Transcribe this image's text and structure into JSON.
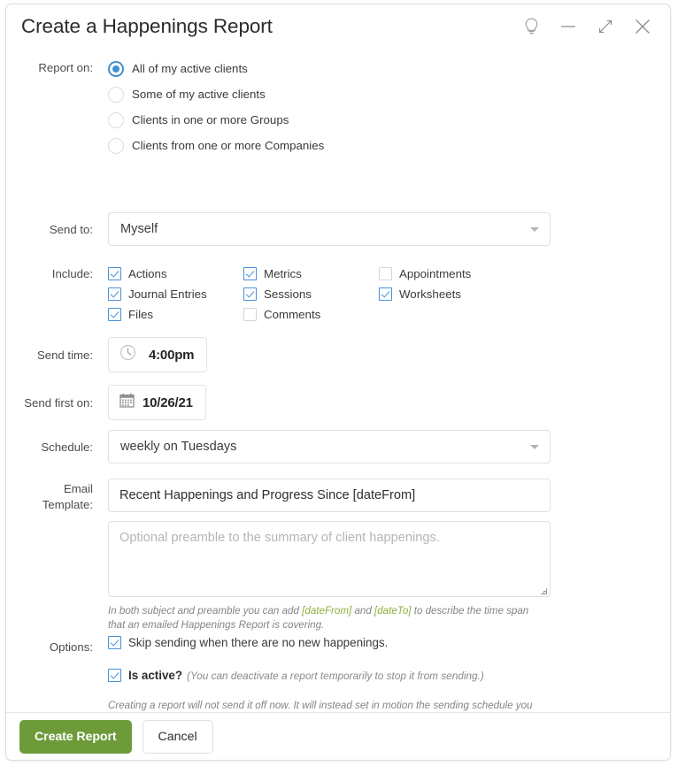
{
  "window": {
    "title": "Create a Happenings Report",
    "controls": [
      {
        "name": "hint-lightbulb-icon",
        "label": "tip"
      },
      {
        "name": "minimize-icon",
        "label": "minimize"
      },
      {
        "name": "collapse-icon",
        "label": "collapse"
      },
      {
        "name": "close-icon",
        "label": "close"
      }
    ]
  },
  "form": {
    "report_on": {
      "label": "Report on:",
      "options": [
        {
          "label": "All of my active clients",
          "selected": true
        },
        {
          "label": "Some of my active clients",
          "selected": false
        },
        {
          "label": "Clients in one or more Groups",
          "selected": false
        },
        {
          "label": "Clients from one or more Companies",
          "selected": false
        }
      ]
    },
    "send_to": {
      "label": "Send to:",
      "value": "Myself"
    },
    "include": {
      "label": "Include:",
      "items": [
        {
          "label": "Actions",
          "checked": true
        },
        {
          "label": "Metrics",
          "checked": true
        },
        {
          "label": "Appointments",
          "checked": false
        },
        {
          "label": "Journal Entries",
          "checked": true
        },
        {
          "label": "Sessions",
          "checked": true
        },
        {
          "label": "Worksheets",
          "checked": true
        },
        {
          "label": "Files",
          "checked": true
        },
        {
          "label": "Comments",
          "checked": false
        }
      ]
    },
    "send_time": {
      "label": "Send time:",
      "value": "4:00pm",
      "icon": "clock-icon"
    },
    "send_first_on": {
      "label": "Send first on:",
      "value": "10/26/21",
      "icon": "calendar-icon"
    },
    "schedule": {
      "label": "Schedule:",
      "value": "weekly on Tuesdays"
    },
    "email_template": {
      "label": "Email\nTemplate:",
      "subject_value": "Recent Happenings and Progress Since [dateFrom]",
      "preamble_placeholder": "Optional preamble to the summary of client happenings.",
      "note_part1": "In both subject and preamble you can add ",
      "note_token1": "[dateFrom]",
      "note_part2": " and ",
      "note_token2": "[dateTo]",
      "note_part3": " to describe the time span that an emailed Happenings Report is covering."
    },
    "options": {
      "label": "Options:",
      "skip_sending": {
        "label": "Skip sending when there are no new happenings.",
        "checked": true
      },
      "is_active": {
        "label": "Is active?",
        "hint": "(You can deactivate a report temporarily to stop it from sending.)",
        "checked": true
      },
      "note": "Creating a report will not send it off now. It will instead set in motion the sending schedule you have defined above. Once created you will be able to preview this report before it is sent."
    }
  },
  "footer": {
    "submit_label": "Create Report",
    "cancel_label": "Cancel"
  },
  "colors": {
    "accent_blue": "#4a90d9",
    "primary_green": "#6d9b3a",
    "token_green": "#8fae3f"
  }
}
